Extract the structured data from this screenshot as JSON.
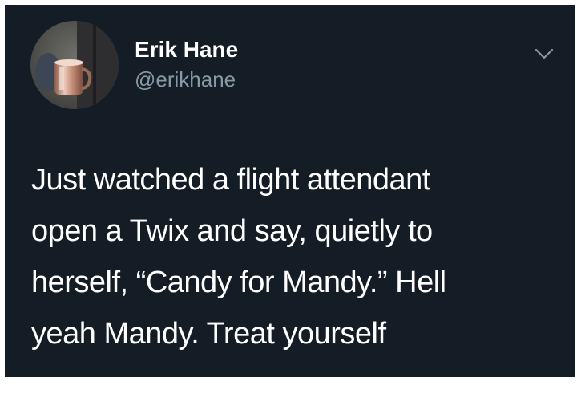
{
  "tweet": {
    "author": {
      "display_name": "Erik Hane",
      "handle": "@erikhane",
      "avatar_icon": "profile-photo-mug"
    },
    "menu_icon": "chevron-down-icon",
    "text_lines": [
      "Just watched a flight attendant",
      "open a Twix and say, quietly to",
      "herself, “Candy for Mandy.” Hell",
      "yeah Mandy. Treat yourself"
    ]
  },
  "colors": {
    "background": "#141d26",
    "text_primary": "#ffffff",
    "text_secondary": "#8899a6"
  }
}
